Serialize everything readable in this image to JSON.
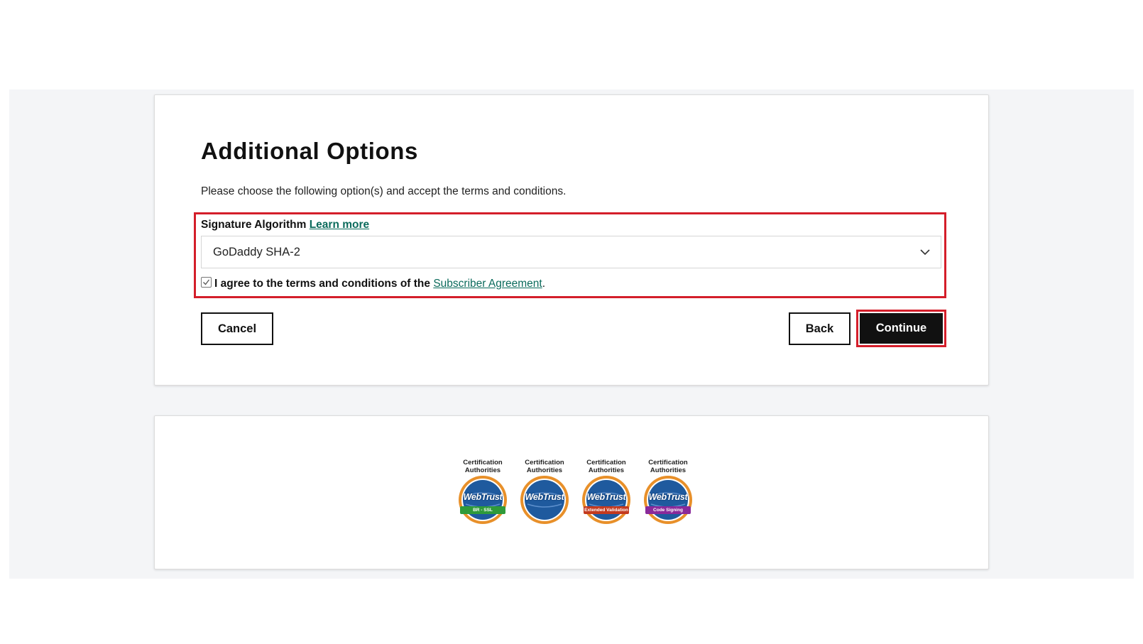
{
  "form": {
    "title": "Additional Options",
    "subtitle": "Please choose the following option(s) and accept the terms and conditions.",
    "signature_label": "Signature Algorithm",
    "learn_more": "Learn more",
    "select_value": "GoDaddy SHA-2",
    "agree_prefix": "I agree to the terms and conditions of the",
    "agreement_link": "Subscriber Agreement",
    "agree_suffix": ".",
    "agree_checked": true,
    "cancel_label": "Cancel",
    "back_label": "Back",
    "continue_label": "Continue"
  },
  "badges": [
    {
      "caption": "Certification Authorities",
      "brand": "WebTrust",
      "ribbon": "BR - SSL",
      "ribbon_color": "#2f9a3a"
    },
    {
      "caption": "Certification Authorities",
      "brand": "WebTrust",
      "ribbon": "",
      "ribbon_color": ""
    },
    {
      "caption": "Certification Authorities",
      "brand": "WebTrust",
      "ribbon": "Extended Validation",
      "ribbon_color": "#c33a1f"
    },
    {
      "caption": "Certification Authorities",
      "brand": "WebTrust",
      "ribbon": "Code Signing",
      "ribbon_color": "#8a2a9a"
    }
  ],
  "colors": {
    "highlight": "#d41e2a",
    "link": "#0b6b5c",
    "primary_button": "#111111",
    "page_background": "#f4f5f7"
  },
  "icons": {
    "select_toggle": "chevron-down-icon",
    "checkbox": "checkmark-icon",
    "badge_seal": "globe-seal-icon"
  }
}
